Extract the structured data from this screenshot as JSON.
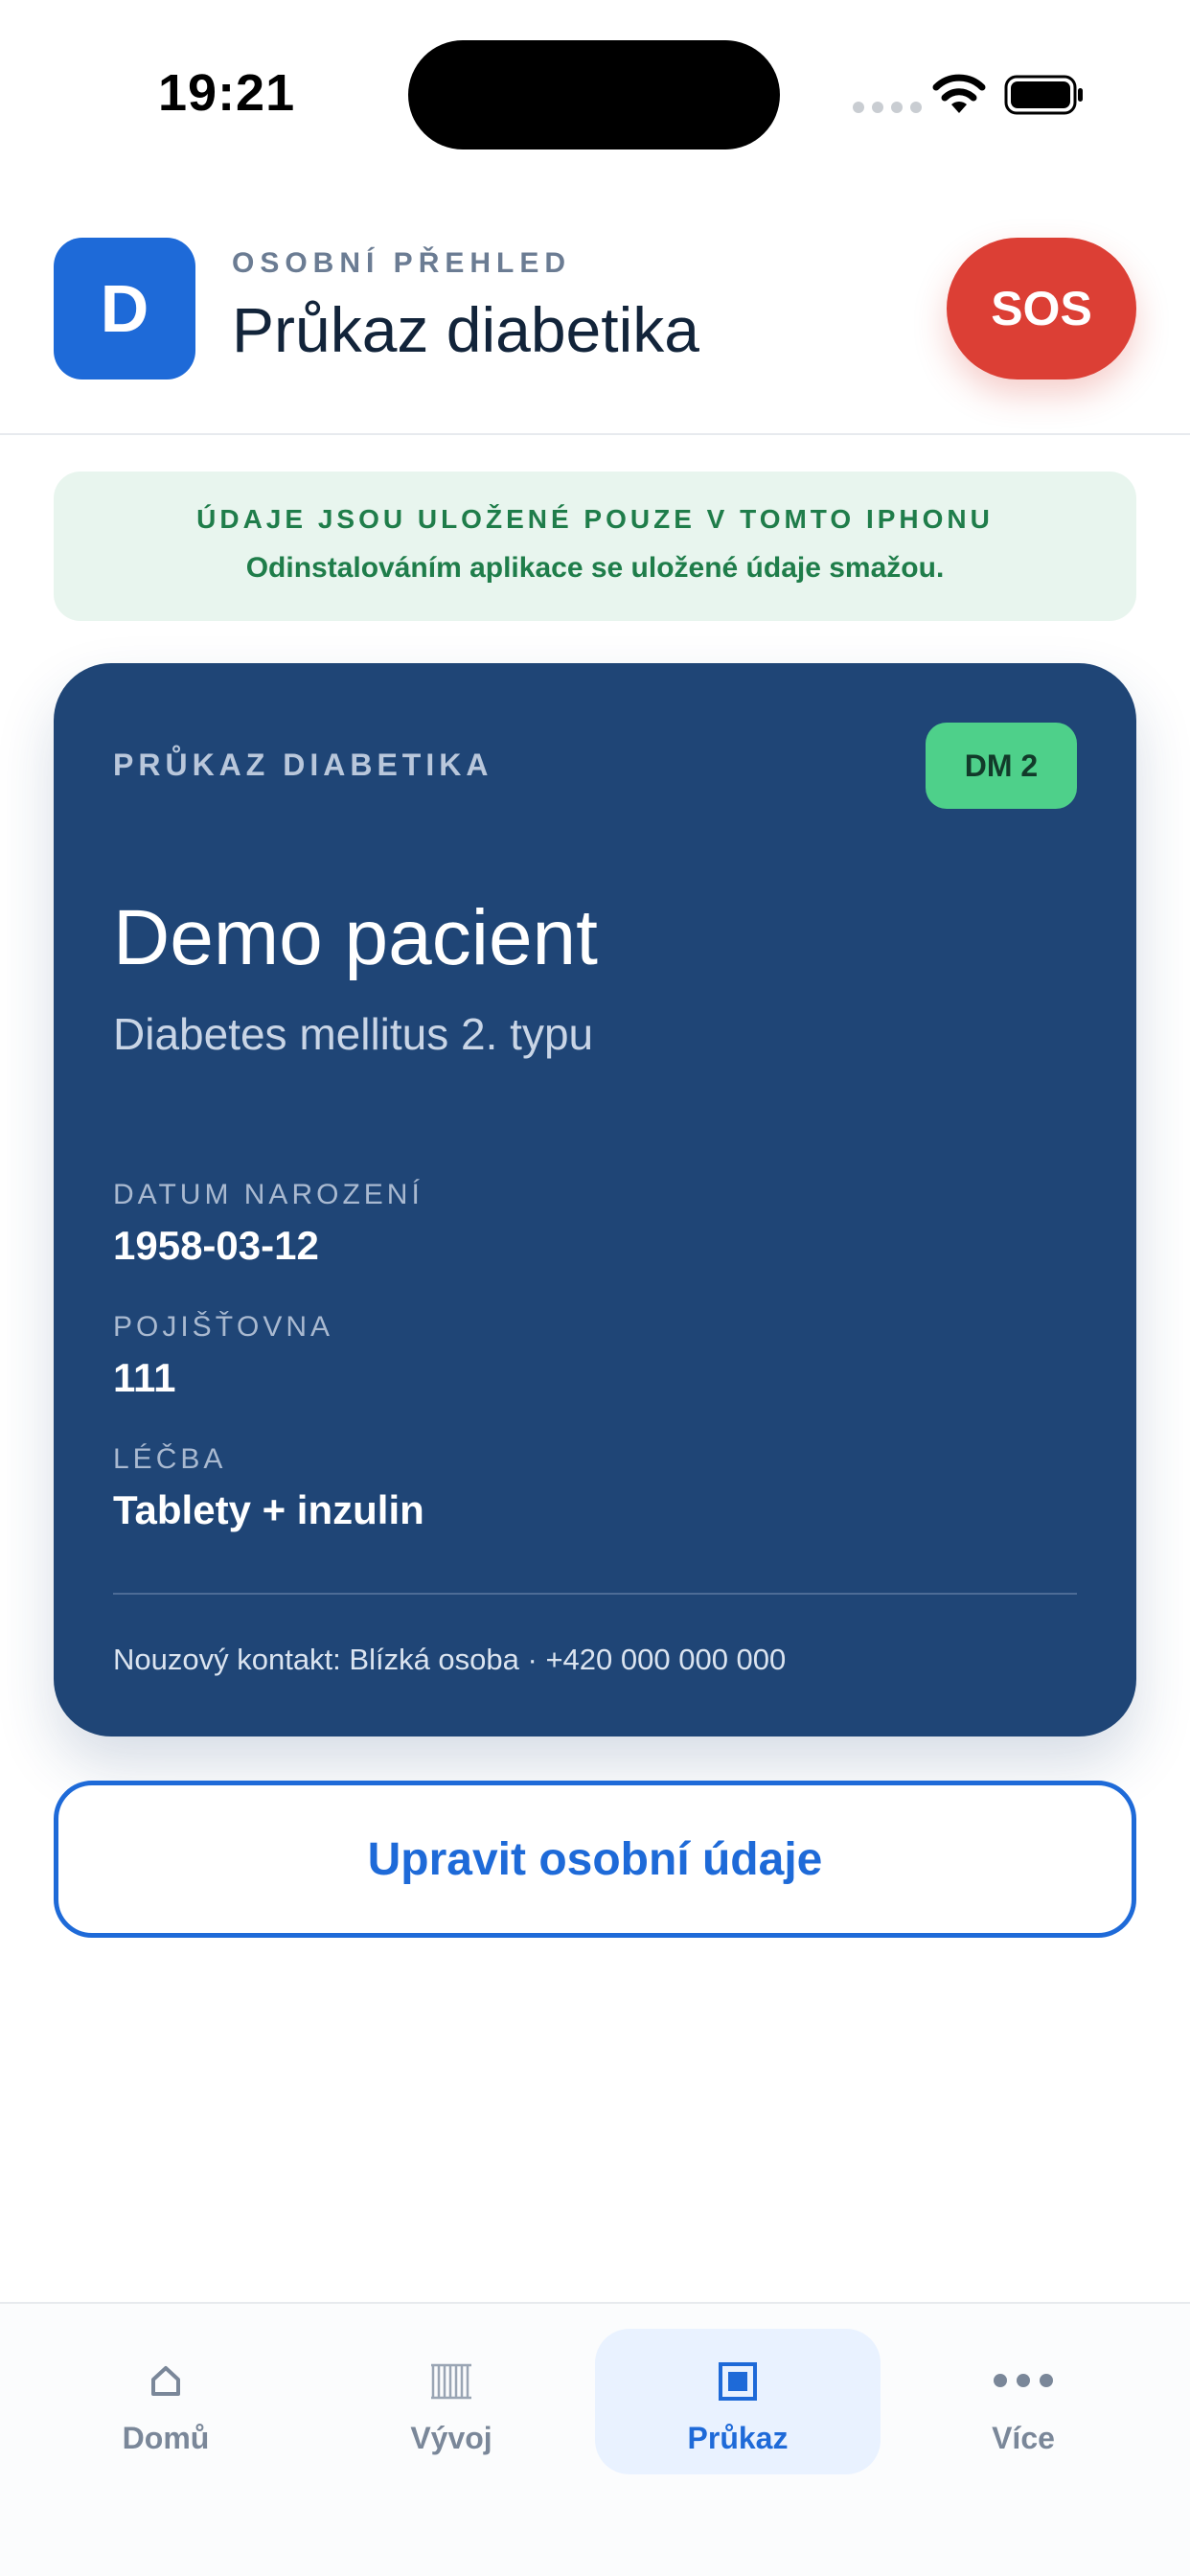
{
  "status_bar": {
    "time": "19:21"
  },
  "header": {
    "app_badge": "D",
    "eyebrow": "OSOBNÍ PŘEHLED",
    "title": "Průkaz diabetika",
    "sos_label": "SOS"
  },
  "notice": {
    "title": "ÚDAJE JSOU ULOŽENÉ POUZE V TOMTO IPHONU",
    "text": "Odinstalováním aplikace se uložené údaje smažou."
  },
  "card": {
    "label": "PRŮKAZ DIABETIKA",
    "tag": "DM 2",
    "name": "Demo pacient",
    "diagnosis": "Diabetes mellitus 2. typu",
    "fields": [
      {
        "label": "DATUM NAROZENÍ",
        "value": "1958-03-12"
      },
      {
        "label": "POJIŠŤOVNA",
        "value": "111"
      },
      {
        "label": "LÉČBA",
        "value": "Tablety + inzulin"
      }
    ],
    "contact": "Nouzový kontakt: Blízká osoba · +420 000 000 000"
  },
  "edit_button_label": "Upravit osobní údaje",
  "tabs": [
    {
      "label": "Domů",
      "icon": "home-icon",
      "active": false
    },
    {
      "label": "Vývoj",
      "icon": "chart-icon",
      "active": false
    },
    {
      "label": "Průkaz",
      "icon": "card-icon",
      "active": true
    },
    {
      "label": "Více",
      "icon": "more-icon",
      "active": false
    }
  ],
  "colors": {
    "primary": "#1e6ad8",
    "card": "#1f4576",
    "sos": "#dc3f35",
    "tag": "#4ed08a",
    "notice_bg": "#e8f5ee",
    "notice_text": "#1f7d4a"
  }
}
